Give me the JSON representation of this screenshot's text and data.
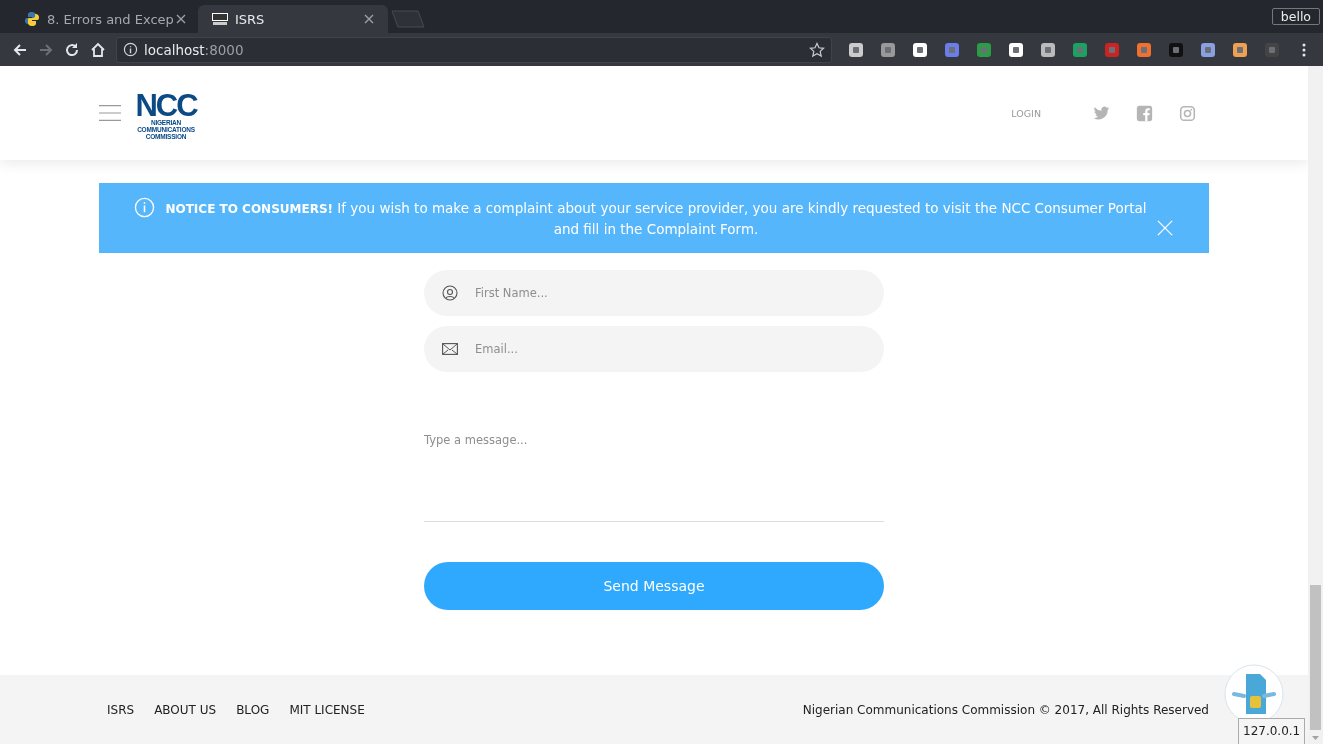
{
  "browser": {
    "tabs": [
      {
        "title": "8. Errors and Excep",
        "selected": false,
        "kind": "python"
      },
      {
        "title": "ISRS",
        "selected": true,
        "kind": "ncc"
      }
    ],
    "profile": "bello",
    "address": {
      "host": "localhost",
      "port": ":8000"
    }
  },
  "header": {
    "logo": {
      "mark": "NCC",
      "lines": [
        "NIGERIAN",
        "COMMUNICATIONS",
        "COMMISSION"
      ]
    },
    "login": "LOGIN"
  },
  "notice": {
    "text": "**NOTICE TO CONSUMERS!** If you wish to make a complaint about your service provider, you are kindly requested to visit the NCC Consumer Portal and fill in the Complaint Form."
  },
  "form": {
    "fields": [
      {
        "kind": "name",
        "placeholder": "First Name..."
      },
      {
        "kind": "email",
        "placeholder": "Email..."
      }
    ],
    "message": {
      "placeholder": "Type a message..."
    },
    "submit": "Send Message"
  },
  "footer": {
    "links": [
      "ISRS",
      "ABOUT US",
      "BLOG",
      "MIT LICENSE"
    ],
    "copyright": "Nigerian Communications Commission © 2017, All Rights Reserved"
  },
  "status_tooltip": "127.0.0.1"
}
